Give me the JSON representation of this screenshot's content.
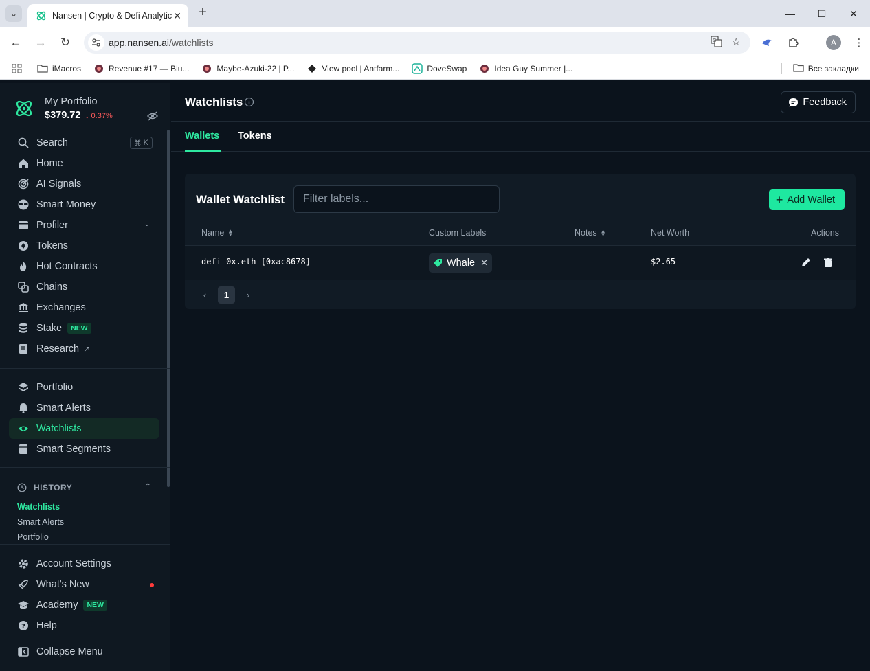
{
  "browser": {
    "tab_title": "Nansen | Crypto & Defi Analytic",
    "url_host": "app.nansen.ai",
    "url_path": "/watchlists",
    "bookmarks": [
      {
        "label": "iMacros",
        "icon": "folder-icon"
      },
      {
        "label": "Revenue #17 — Blu...",
        "icon": "site-icon"
      },
      {
        "label": "Maybe-Azuki-22 | P...",
        "icon": "site-icon"
      },
      {
        "label": "View pool | Antfarm...",
        "icon": "site-icon"
      },
      {
        "label": "DoveSwap",
        "icon": "site-icon"
      },
      {
        "label": "Idea Guy Summer |...",
        "icon": "site-icon"
      }
    ],
    "all_bookmarks": "Все закладки",
    "profile_initial": "A"
  },
  "sidebar": {
    "portfolio_title": "My Portfolio",
    "portfolio_value": "$379.72",
    "portfolio_change": "↓ 0.37%",
    "search": {
      "label": "Search",
      "shortcut_symbol": "⌘",
      "shortcut_key": "K"
    },
    "items": [
      {
        "label": "Home",
        "icon": "home-icon"
      },
      {
        "label": "AI Signals",
        "icon": "ai-signals-icon"
      },
      {
        "label": "Smart Money",
        "icon": "sunglasses-icon"
      },
      {
        "label": "Profiler",
        "icon": "profiler-icon"
      },
      {
        "label": "Tokens",
        "icon": "token-icon"
      },
      {
        "label": "Hot Contracts",
        "icon": "flame-icon"
      },
      {
        "label": "Chains",
        "icon": "chains-icon"
      },
      {
        "label": "Exchanges",
        "icon": "bank-icon"
      },
      {
        "label": "Stake",
        "icon": "stake-icon",
        "badge": "NEW"
      },
      {
        "label": "Research",
        "icon": "research-icon"
      }
    ],
    "items2": [
      {
        "label": "Portfolio",
        "icon": "layers-icon"
      },
      {
        "label": "Smart Alerts",
        "icon": "bell-icon"
      },
      {
        "label": "Watchlists",
        "icon": "eye-icon"
      },
      {
        "label": "Smart Segments",
        "icon": "segments-icon"
      }
    ],
    "history": {
      "title": "HISTORY",
      "items": [
        "Watchlists",
        "Smart Alerts",
        "Portfolio"
      ]
    },
    "bottom": [
      {
        "label": "Account Settings",
        "icon": "gear-icon"
      },
      {
        "label": "What's New",
        "icon": "rocket-icon"
      },
      {
        "label": "Academy",
        "icon": "graduation-cap-icon",
        "badge": "NEW"
      },
      {
        "label": "Help",
        "icon": "help-icon"
      },
      {
        "label": "Collapse Menu",
        "icon": "collapse-icon"
      }
    ]
  },
  "main": {
    "title": "Watchlists",
    "feedback_label": "Feedback",
    "tabs": [
      "Wallets",
      "Tokens"
    ],
    "card": {
      "title": "Wallet Watchlist",
      "filter_placeholder": "Filter labels...",
      "add_label": "Add Wallet",
      "columns": [
        "Name",
        "Custom Labels",
        "Notes",
        "Net Worth",
        "Actions"
      ],
      "rows": [
        {
          "name": "defi-0x.eth [0xac8678]",
          "label": "Whale",
          "notes": "-",
          "net_worth": "$2.65"
        }
      ],
      "page": "1"
    }
  },
  "colors": {
    "accent": "#2ee8a0",
    "button": "#1ee8a0",
    "negative": "#ff5b5b",
    "background": "#0b131c"
  }
}
